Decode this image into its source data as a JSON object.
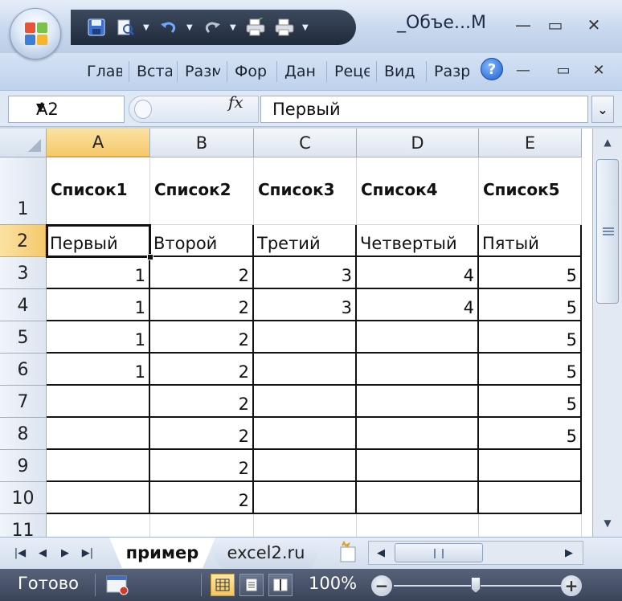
{
  "window": {
    "title": "_Объе...М",
    "controls": {
      "minimize": "—",
      "maximize": "▭",
      "close": "✕"
    },
    "child_controls": {
      "minimize": "—",
      "restore": "▭",
      "close": "✕"
    }
  },
  "qat_icons": [
    "save-icon",
    "print-preview-icon",
    "undo-icon",
    "redo-icon",
    "quick-print-icon",
    "print-icon"
  ],
  "ribbon": {
    "tabs": [
      "Глав",
      "Вста",
      "Разм",
      "Фор",
      "Дан",
      "Реце",
      "Вид",
      "Разр"
    ],
    "help_label": "?"
  },
  "formula_bar": {
    "name_box": "A2",
    "fx_label": "fx",
    "value": "Первый",
    "expand_label": "⌄"
  },
  "sheet": {
    "columns": [
      "A",
      "B",
      "C",
      "D",
      "E"
    ],
    "rows": [
      "1",
      "2",
      "3",
      "4",
      "5",
      "6",
      "7",
      "8",
      "9",
      "10",
      "11"
    ],
    "selected_column": "A",
    "selected_row": "2",
    "cells": [
      [
        "Список1",
        "Список2",
        "Список3",
        "Список4",
        "Список5"
      ],
      [
        "Первый",
        "Второй",
        "Третий",
        "Четвертый",
        "Пятый"
      ],
      [
        "1",
        "2",
        "3",
        "4",
        "5"
      ],
      [
        "1",
        "2",
        "3",
        "4",
        "5"
      ],
      [
        "1",
        "2",
        "",
        "",
        "5"
      ],
      [
        "1",
        "2",
        "",
        "",
        "5"
      ],
      [
        "",
        "2",
        "",
        "",
        "5"
      ],
      [
        "",
        "2",
        "",
        "",
        "5"
      ],
      [
        "",
        "2",
        "",
        "",
        ""
      ],
      [
        "",
        "2",
        "",
        "",
        ""
      ],
      [
        "",
        "",
        "",
        "",
        ""
      ]
    ]
  },
  "sheet_tabs": {
    "nav": [
      "|◀",
      "◀",
      "▶",
      "▶|"
    ],
    "tabs": [
      "пример",
      "excel2.ru"
    ],
    "active": "пример"
  },
  "status": {
    "text": "Готово",
    "zoom": "100%",
    "zoom_out": "−",
    "zoom_in": "+"
  }
}
